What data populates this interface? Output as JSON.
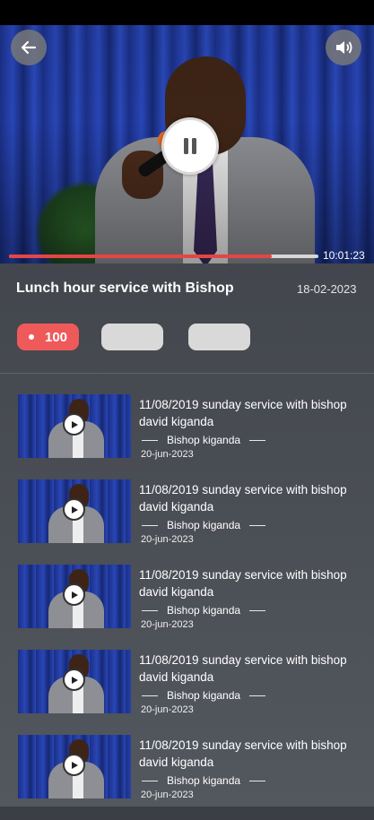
{
  "player": {
    "time": "10:01:23",
    "progress": 0.85,
    "back_icon": "arrow-left-icon",
    "volume_icon": "volume-icon",
    "pause_icon": "pause-icon"
  },
  "video": {
    "title": "Lunch hour service with Bishop",
    "date": "18-02-2023"
  },
  "pills": {
    "views": "100"
  },
  "colors": {
    "accent": "#ee5a5a",
    "progress": "#e64545"
  },
  "list": [
    {
      "title": "11/08/2019 sunday service with bishop david kiganda",
      "author": "Bishop kiganda",
      "date": "20-jun-2023"
    },
    {
      "title": "11/08/2019 sunday service with bishop david kiganda",
      "author": "Bishop kiganda",
      "date": "20-jun-2023"
    },
    {
      "title": "11/08/2019 sunday service with bishop david kiganda",
      "author": "Bishop kiganda",
      "date": "20-jun-2023"
    },
    {
      "title": "11/08/2019 sunday service with bishop david kiganda",
      "author": "Bishop kiganda",
      "date": "20-jun-2023"
    },
    {
      "title": "11/08/2019 sunday service with bishop david kiganda",
      "author": "Bishop kiganda",
      "date": "20-jun-2023"
    }
  ]
}
